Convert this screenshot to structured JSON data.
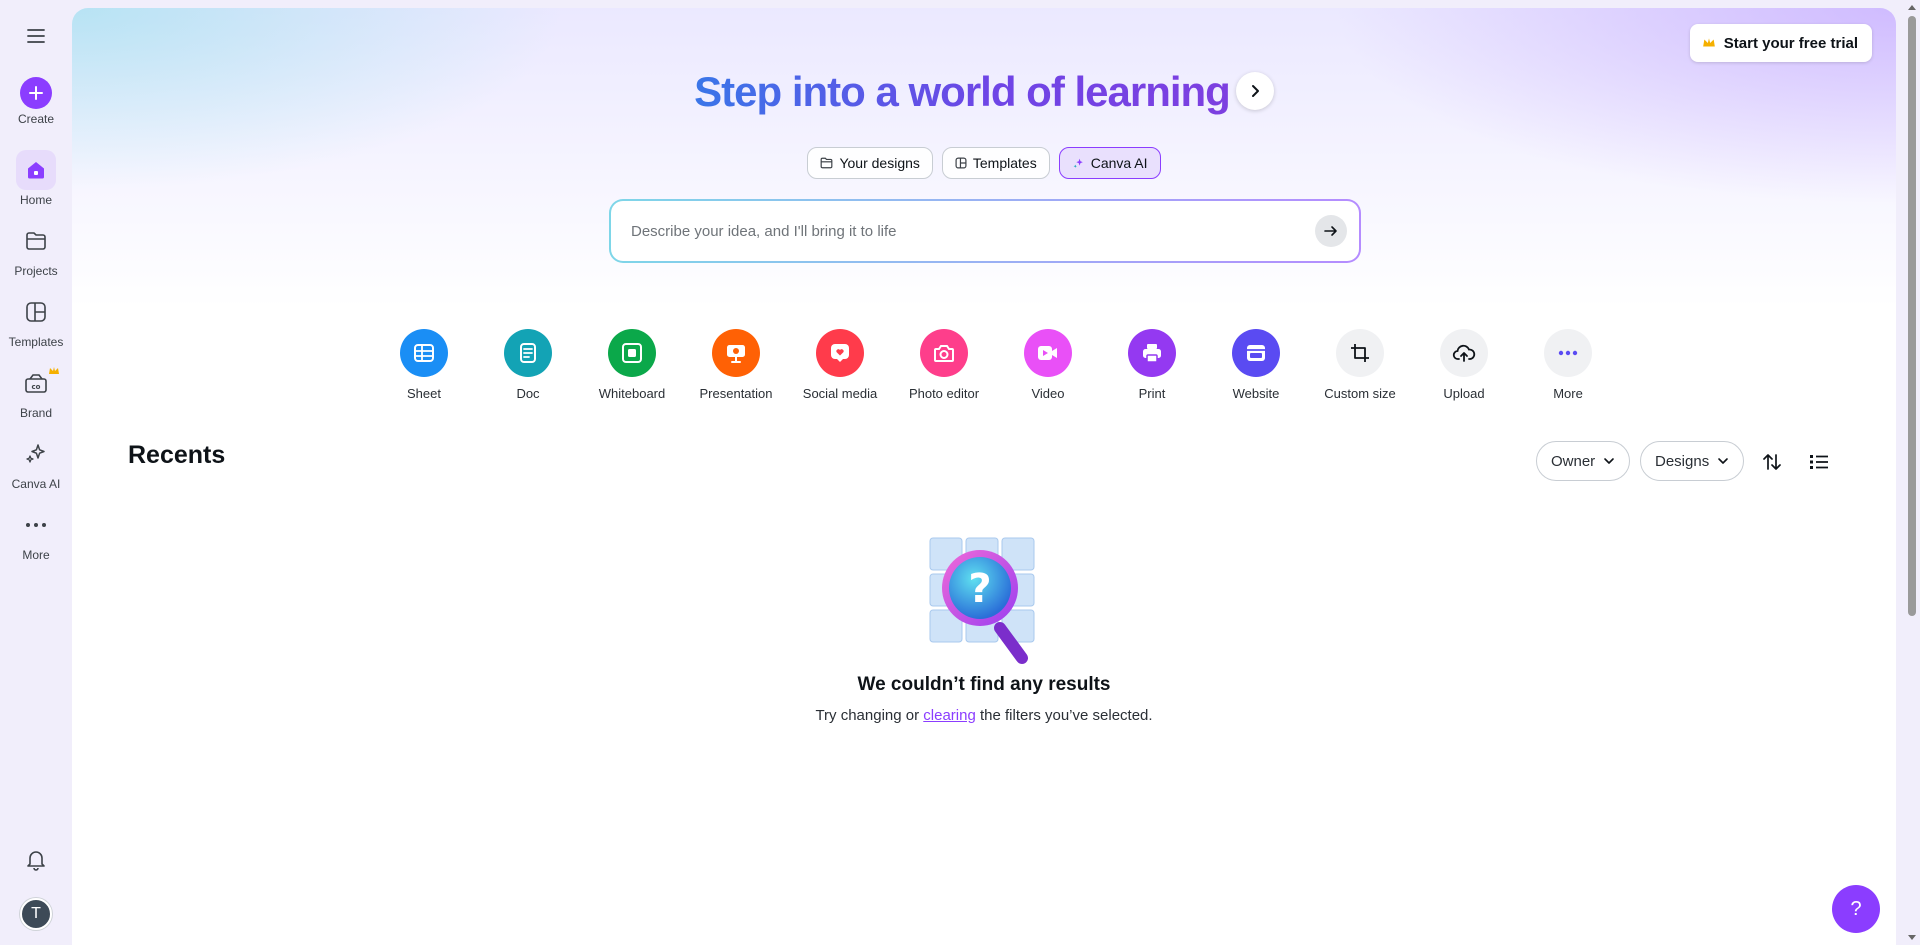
{
  "sidebar": {
    "create": "Create",
    "items": [
      {
        "label": "Home"
      },
      {
        "label": "Projects"
      },
      {
        "label": "Templates"
      },
      {
        "label": "Brand"
      },
      {
        "label": "Canva AI"
      },
      {
        "label": "More"
      }
    ],
    "avatar_initial": "T"
  },
  "header": {
    "trial_label": "Start your free trial",
    "title": "Step into a world of learning"
  },
  "tabs": [
    {
      "label": "Your designs"
    },
    {
      "label": "Templates"
    },
    {
      "label": "Canva AI"
    }
  ],
  "search": {
    "placeholder": "Describe your idea, and I'll bring it to life",
    "value": ""
  },
  "quick_actions": [
    {
      "label": "Sheet",
      "color": "#1a8ef5"
    },
    {
      "label": "Doc",
      "color": "#13a3b5"
    },
    {
      "label": "Whiteboard",
      "color": "#0ba84a"
    },
    {
      "label": "Presentation",
      "color": "#ff6105"
    },
    {
      "label": "Social media",
      "color": "#ff3b4b"
    },
    {
      "label": "Photo editor",
      "color": "#fe3e8b"
    },
    {
      "label": "Video",
      "color": "#e950f7"
    },
    {
      "label": "Print",
      "color": "#9439f1"
    },
    {
      "label": "Website",
      "color": "#5a4bf2"
    },
    {
      "label": "Custom size",
      "color": "#f0f1f3"
    },
    {
      "label": "Upload",
      "color": "#f0f1f3"
    },
    {
      "label": "More",
      "color": "#f0f1f3"
    }
  ],
  "recents": {
    "title": "Recents",
    "owner_label": "Owner",
    "designs_label": "Designs",
    "empty_title": "We couldn’t find any results",
    "empty_pre": "Try changing or ",
    "empty_link": "clearing",
    "empty_post": " the filters you’ve selected."
  },
  "help_label": "?",
  "colors": {
    "accent": "#8b3dff"
  }
}
